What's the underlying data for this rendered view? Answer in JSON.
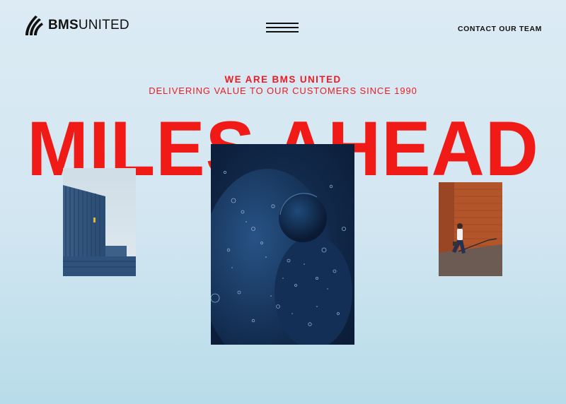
{
  "header": {
    "logo": {
      "brand_bold": "BMS",
      "brand_light": "UNITED",
      "icon": "bms-stripes-logo"
    },
    "menu_icon": "hamburger-icon",
    "contact_label": "CONTACT OUR TEAM"
  },
  "hero": {
    "eyebrow": "WE ARE BMS UNITED",
    "subline": "DELIVERING VALUE TO OUR CUSTOMERS SINCE 1990",
    "headline": "MILES AHEAD"
  },
  "images": [
    {
      "name": "shipping-container-photo"
    },
    {
      "name": "water-bubbles-photo"
    },
    {
      "name": "person-walking-photo"
    }
  ],
  "colors": {
    "accent": "#ea1c24",
    "headline": "#f01b17",
    "text": "#111111",
    "background_top": "#dcebf4",
    "background_bottom": "#b8dcea"
  }
}
